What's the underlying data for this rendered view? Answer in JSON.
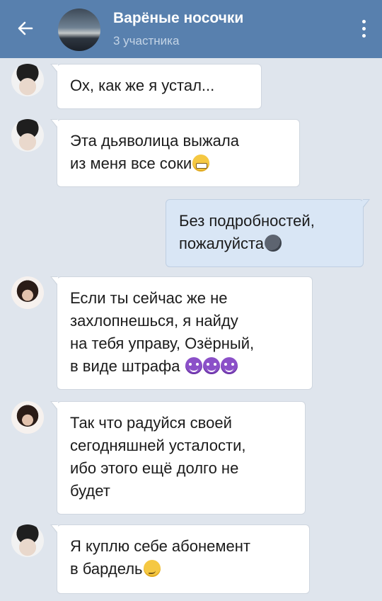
{
  "header": {
    "title": "Варёные носочки",
    "subtitle": "3 участника",
    "back_icon": "arrow-left-icon",
    "menu_icon": "more-vertical-icon",
    "background_color": "#5880ae"
  },
  "messages": [
    {
      "direction": "incoming",
      "sender": "male",
      "text": "Ох, как же я устал...",
      "emoji": []
    },
    {
      "direction": "incoming",
      "sender": "male",
      "text_lines": [
        "Эта дьяволица выжала",
        "из меня все соки"
      ],
      "emoji": [
        "grimacing"
      ]
    },
    {
      "direction": "outgoing",
      "text_lines": [
        "Без подробностей,",
        "пожалуйста"
      ],
      "emoji": [
        "new-moon-face"
      ]
    },
    {
      "direction": "incoming",
      "sender": "female",
      "text_lines": [
        "Если ты сейчас же не",
        "захлопнешься, я найду",
        "на тебя управу, Озёрный,",
        "в виде штрафа "
      ],
      "emoji": [
        "smiling-imp",
        "smiling-imp",
        "smiling-imp"
      ]
    },
    {
      "direction": "incoming",
      "sender": "female",
      "text_lines": [
        "Так что радуйся своей",
        "сегодняшней усталости,",
        "ибо этого ещё долго не",
        "будет"
      ],
      "emoji": []
    },
    {
      "direction": "incoming",
      "sender": "male",
      "text_lines": [
        "Я куплю себе абонемент",
        "в бардель"
      ],
      "emoji": [
        "smirking-face"
      ]
    }
  ],
  "colors": {
    "chat_background": "#dfe5ed",
    "incoming_bubble": "#ffffff",
    "outgoing_bubble": "#d9e6f5"
  }
}
